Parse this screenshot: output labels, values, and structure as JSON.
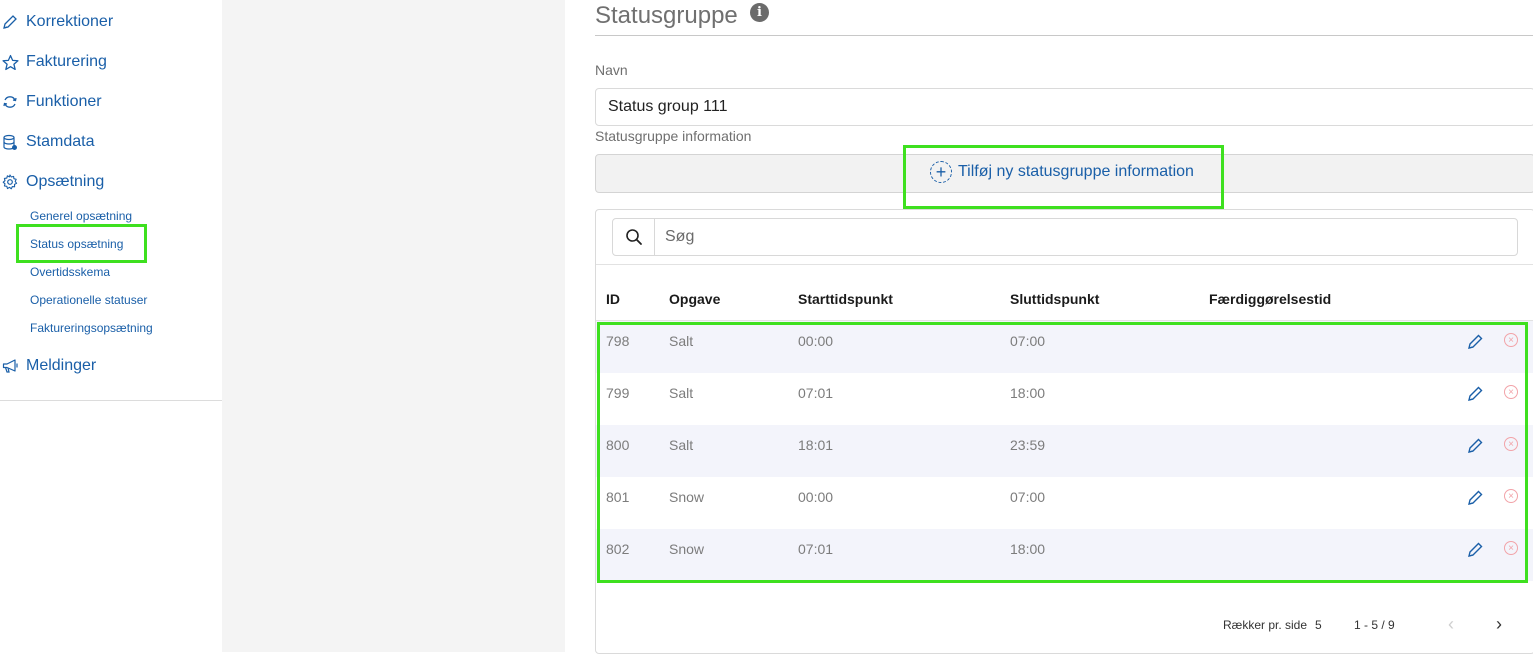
{
  "sidebar": {
    "items": [
      {
        "label": "Korrektioner",
        "icon": "pencil-icon"
      },
      {
        "label": "Fakturering",
        "icon": "star-icon"
      },
      {
        "label": "Funktioner",
        "icon": "refresh-icon"
      },
      {
        "label": "Stamdata",
        "icon": "database-icon"
      },
      {
        "label": "Opsætning",
        "icon": "gear-icon"
      }
    ],
    "sub_items": [
      {
        "label": "Generel opsætning"
      },
      {
        "label": "Status opsætning",
        "active": true
      },
      {
        "label": "Overtidsskema"
      },
      {
        "label": "Operationelle statuser"
      },
      {
        "label": "Faktureringsopsætning"
      }
    ],
    "messages": {
      "label": "Meldinger",
      "icon": "megaphone-icon"
    }
  },
  "main": {
    "title": "Statusgruppe",
    "name_label": "Navn",
    "name_value": "Status group 111",
    "info_label": "Statusgruppe information",
    "add_button": "Tilføj ny statusgruppe information",
    "search_placeholder": "Søg",
    "table": {
      "headers": [
        "ID",
        "Opgave",
        "Starttidspunkt",
        "Sluttidspunkt",
        "Færdiggørelsestid"
      ],
      "rows": [
        {
          "id": "798",
          "task": "Salt",
          "start": "00:00",
          "end": "07:00",
          "completion": ""
        },
        {
          "id": "799",
          "task": "Salt",
          "start": "07:01",
          "end": "18:00",
          "completion": ""
        },
        {
          "id": "800",
          "task": "Salt",
          "start": "18:01",
          "end": "23:59",
          "completion": ""
        },
        {
          "id": "801",
          "task": "Snow",
          "start": "00:00",
          "end": "07:00",
          "completion": ""
        },
        {
          "id": "802",
          "task": "Snow",
          "start": "07:01",
          "end": "18:00",
          "completion": ""
        }
      ]
    },
    "pagination": {
      "rows_per_page_label": "Rækker pr. side",
      "rows_per_page": "5",
      "range": "1 - 5 / 9"
    }
  },
  "colors": {
    "accent": "#1a5fa8",
    "highlight": "#3ee01f",
    "row_alt": "#f3f4fb",
    "delete": "#f2a3a8"
  }
}
